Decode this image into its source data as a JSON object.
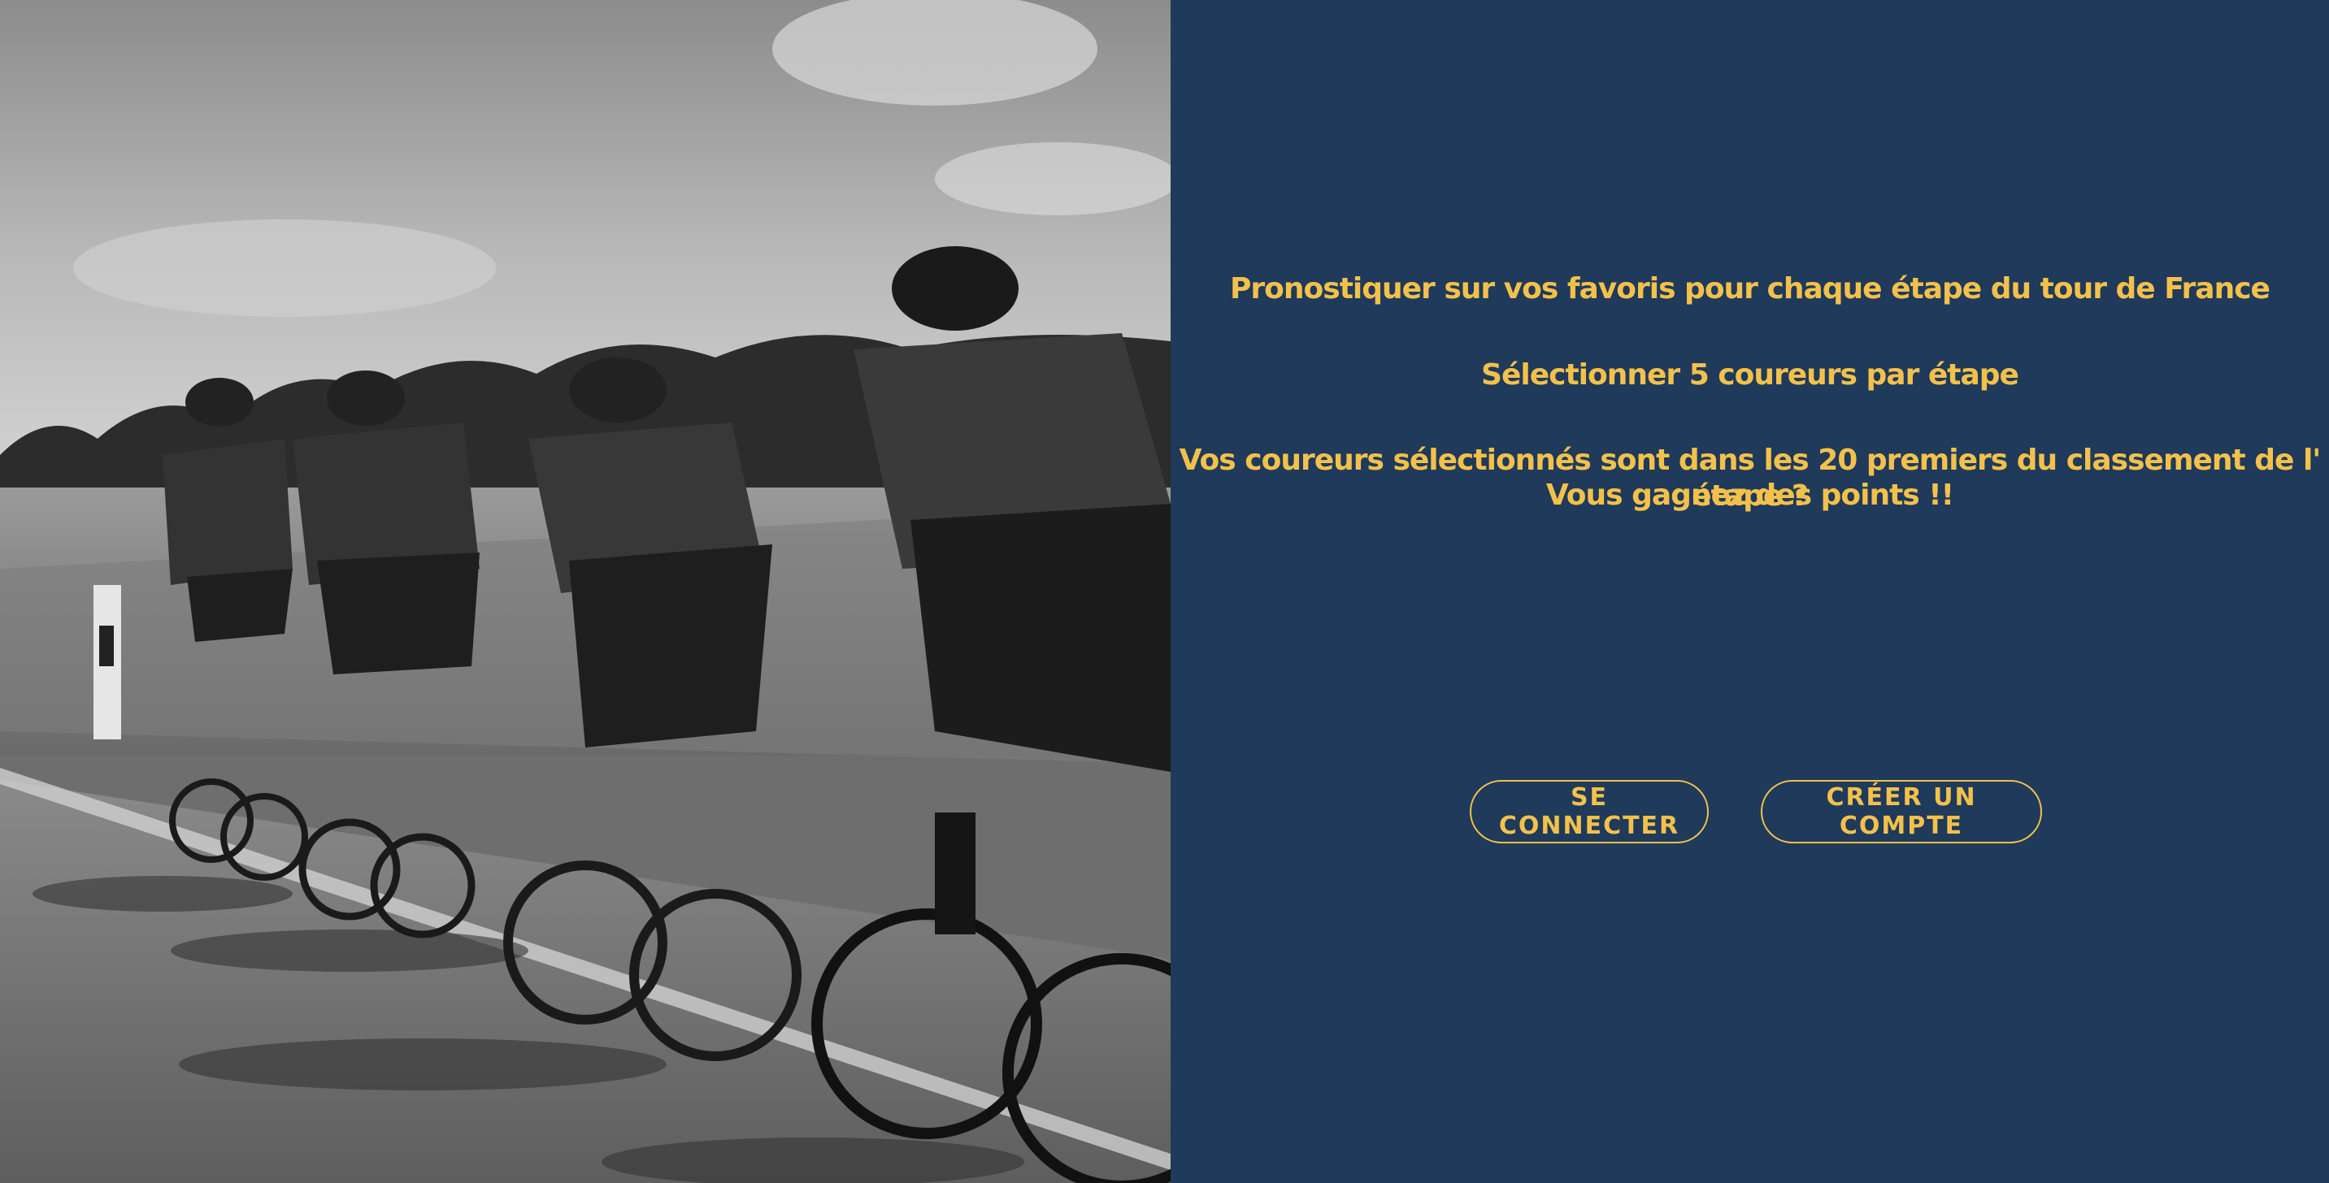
{
  "hero_image": {
    "description_icon": "cyclists-photo",
    "style": "grayscale"
  },
  "content": {
    "line_1": "Pronostiquer sur vos favoris pour chaque étape du tour de France",
    "line_2": "Sélectionner 5 coureurs par étape",
    "line_3": "Vos coureurs sélectionnés sont dans les 20 premiers du classement de l' étape ?",
    "line_4": "Vous gagnez des points !!"
  },
  "actions": {
    "login_label": "SE CONNECTER",
    "signup_label": "CRÉER UN COMPTE"
  },
  "colors": {
    "panel_background": "#1f3a5a",
    "accent": "#f3c14b"
  }
}
